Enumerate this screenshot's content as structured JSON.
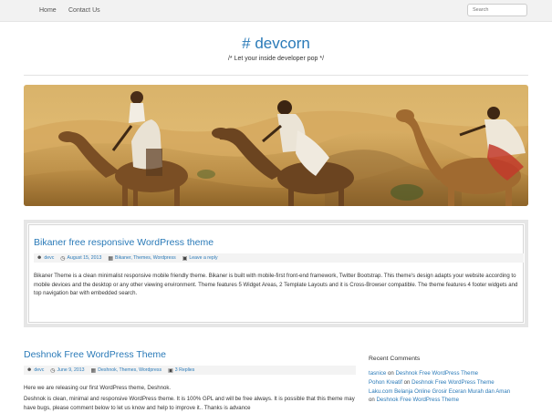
{
  "nav": {
    "home": "Home",
    "contact": "Contact Us",
    "search_placeholder": "Search"
  },
  "site": {
    "title": "# devcorn",
    "tagline": "/* Let your inside developer pop */"
  },
  "featured": {
    "title": "Bikaner free responsive WordPress theme",
    "author": "devc",
    "date": "August 15, 2013",
    "categories": "Bikaner, Themes, Wordpress",
    "reply": "Leave a reply",
    "excerpt": "Bikaner Theme is a clean minimalist responsive mobile friendly theme. Bikaner is built with mobile-first front-end framework, Twitter Bootstrap. This theme's design adapts your website according to mobile devices and the desktop or any other viewing environment. Theme features 5 Widget Areas, 2 Template Layouts and it is Cross-Browser compatible. The theme features 4 footer widgets and top navigation bar with embedded search."
  },
  "post": {
    "title": "Deshnok Free WordPress Theme",
    "author": "devc",
    "date": "June 9, 2013",
    "categories": "Deshnok, Themes, Wordpress",
    "replies": "3 Replies",
    "p1": "Here we are releasing our first WordPress theme, Deshnok.",
    "p2": "Deshnok is clean, minimal and responsive WordPress theme. It is 100% GPL and will be free always.  It is possible that this theme may have bugs, please comment below to let us know and help to improve it.. Thanks is advance"
  },
  "sidebar": {
    "title": "Recent Comments",
    "comments": [
      {
        "author": "tasnice",
        "on": "on",
        "post": "Deshnok Free WordPress Theme"
      },
      {
        "author": "Pohon Kreatif",
        "on": "on",
        "post": "Deshnok Free WordPress Theme"
      },
      {
        "author": "Laku.com Belanja Online Grosir Eceran Murah dan Aman",
        "on": "",
        "post": ""
      },
      {
        "author": "",
        "on": "on",
        "post": "Deshnok Free WordPress Theme"
      }
    ]
  },
  "icons": {
    "user": "user-icon",
    "clock": "clock-icon",
    "folder": "folder-icon",
    "comment": "comment-icon"
  },
  "colors": {
    "link": "#2a7ab8",
    "topbar": "#f2f2f2",
    "meta_bg": "#f3f3f3"
  }
}
